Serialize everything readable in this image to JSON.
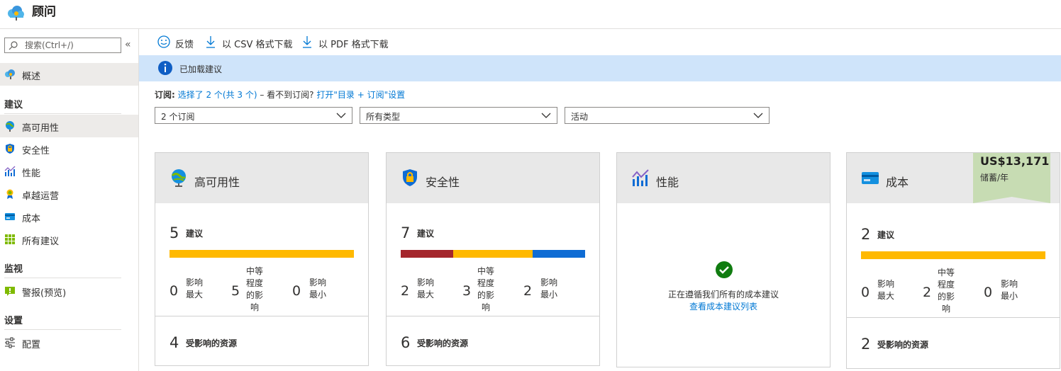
{
  "app": {
    "title": "顾问"
  },
  "sidebar": {
    "search_placeholder": "搜索(Ctrl+/)",
    "collapse_glyph": "«",
    "overview": "概述",
    "sections": {
      "recommendations": "建议",
      "monitoring": "监视",
      "settings": "设置"
    },
    "items": {
      "high_availability": "高可用性",
      "security": "安全性",
      "performance": "性能",
      "operational_excellence": "卓越运营",
      "cost": "成本",
      "all_recommendations": "所有建议",
      "alerts": "警报(预览)",
      "configuration": "配置"
    }
  },
  "toolbar": {
    "feedback": "反馈",
    "download_csv": "以 CSV 格式下载",
    "download_pdf": "以 PDF 格式下载"
  },
  "banner": {
    "text": "已加载建议"
  },
  "subscriptions": {
    "label": "订阅:",
    "selected_link": "选择了 2 个(共 3 个)",
    "separator": " – 看不到订阅? ",
    "settings_link": "打开\"目录 + 订阅\"设置"
  },
  "filters": {
    "subscriptions": "2 个订阅",
    "types": "所有类型",
    "status": "活动"
  },
  "cards": {
    "high_availability": {
      "title": "高可用性",
      "count": "5",
      "count_label": "建议",
      "impact": {
        "high_value": "0",
        "high_label": "影响\n最大",
        "med_value": "5",
        "med_label": "中等\n程度\n的影\n响",
        "low_value": "0",
        "low_label": "影响\n最小"
      },
      "resources_value": "4",
      "resources_label": "受影响的资源",
      "bar": [
        {
          "share": 1.0,
          "color": "#ffb900"
        }
      ]
    },
    "security": {
      "title": "安全性",
      "count": "7",
      "count_label": "建议",
      "impact": {
        "high_value": "2",
        "high_label": "影响\n最大",
        "med_value": "3",
        "med_label": "中等\n程度\n的影\n响",
        "low_value": "2",
        "low_label": "影响\n最小"
      },
      "resources_value": "6",
      "resources_label": "受影响的资源",
      "bar": [
        {
          "share": 0.2857,
          "color": "#a4262c"
        },
        {
          "share": 0.4286,
          "color": "#ffb900"
        },
        {
          "share": 0.2857,
          "color": "#0f6cd4"
        }
      ]
    },
    "performance": {
      "title": "性能",
      "message": "正在遵循我们所有的成本建议",
      "link": "查看成本建议列表"
    },
    "cost": {
      "title": "成本",
      "savings_amount": "US$13,171",
      "savings_period": "储蓄/年",
      "count": "2",
      "count_label": "建议",
      "impact": {
        "high_value": "0",
        "high_label": "影响\n最大",
        "med_value": "2",
        "med_label": "中等\n程度\n的影\n响",
        "low_value": "0",
        "low_label": "影响\n最小"
      },
      "resources_value": "2",
      "resources_label": "受影响的资源",
      "bar": [
        {
          "share": 1.0,
          "color": "#ffb900"
        }
      ]
    }
  },
  "colors": {
    "accent": "#0078d4",
    "banner": "#cfe4fa",
    "high_impact": "#a4262c",
    "medium_impact": "#ffb900",
    "low_impact": "#0f6cd4",
    "success": "#107c10",
    "savings_tag": "#c7dcb3"
  },
  "icons": {
    "app": "advisor-cloud-icon",
    "search": "search-icon",
    "feedback": "smiley-icon",
    "download": "download-icon",
    "info": "info-icon",
    "high_availability": "globe-icon",
    "security": "shield-icon",
    "performance": "performance-chart-icon",
    "operational_excellence": "award-icon",
    "cost": "credit-card-icon",
    "all_recommendations": "grid-icon",
    "alerts": "alert-icon",
    "configuration": "sliders-icon",
    "success": "checkmark-circle-icon"
  }
}
